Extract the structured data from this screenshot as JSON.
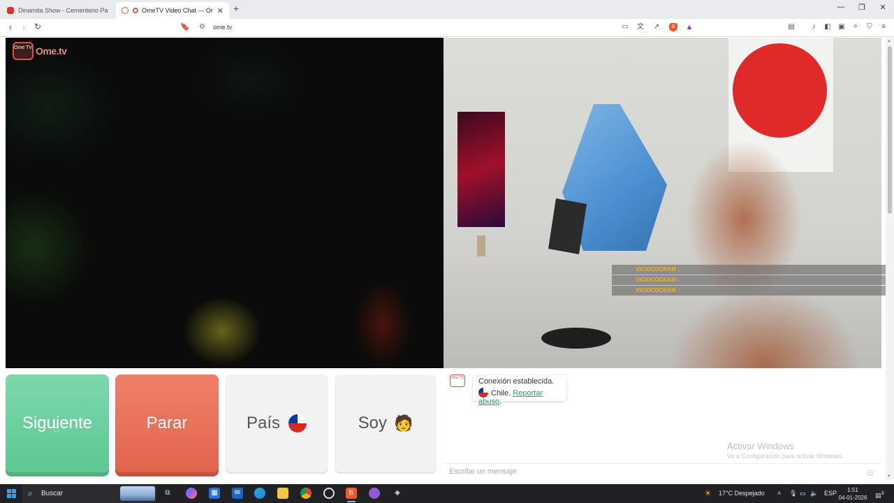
{
  "browser": {
    "tabs": [
      {
        "title": "Dinamita Show - Cementerio Pal Pha",
        "active": false
      },
      {
        "title": "OmeTV Video Chat — Omeg",
        "active": true
      }
    ],
    "new_tab": "+",
    "url": "ome.tv"
  },
  "ome": {
    "logo_badge": "Ome TV",
    "logo_text": "Ome.tv"
  },
  "stream_overlay": {
    "rows": [
      "VICIOCOCKKM :",
      "VICIOCOCKKM :",
      "VICIOCOCKKM :"
    ]
  },
  "controls": {
    "next_label": "Siguiente",
    "stop_label": "Parar",
    "country_label": "País",
    "gender_label": "Soy",
    "gender_emoji": "🧑"
  },
  "chat": {
    "logo_badge": "Ome TV",
    "status_line": "Conexión establecida.",
    "country": "Chile.",
    "report_link": "Reportar abuso",
    "report_suffix": ".",
    "input_placeholder": "Escribe un mensaje",
    "watermark_title": "Activar Windows",
    "watermark_sub": "Ve a Configuración para activar Windows."
  },
  "taskbar": {
    "search_label": "Buscar",
    "weather": "17°C  Despejado",
    "language": "ESP",
    "time": "1:51",
    "date": "04-01-2026",
    "notification_count": "3"
  },
  "colors": {
    "next_green": "#5ec793",
    "stop_red": "#e3644d",
    "link_green": "#2e9e7a",
    "brand_red": "#d9534f"
  }
}
